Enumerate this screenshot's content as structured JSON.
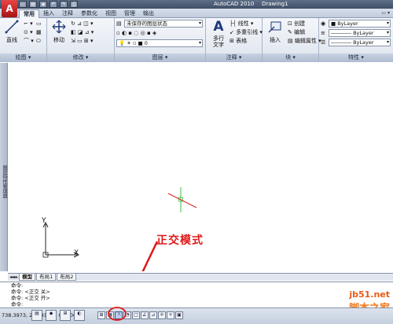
{
  "title_bar": {
    "app_title": "AutoCAD 2010",
    "doc_title": "Drawing1",
    "logo_letter": "A"
  },
  "ribbon_tabs": [
    "常用",
    "插入",
    "注释",
    "参数化",
    "视图",
    "管理",
    "输出"
  ],
  "panels": {
    "draw": {
      "title": "绘图",
      "line_label": "直线"
    },
    "modify": {
      "title": "修改",
      "move_label": "移动"
    },
    "layers": {
      "title": "图层",
      "layer_state": "未保存的图层状态",
      "current_layer": "0"
    },
    "annotation": {
      "title": "注释",
      "mtext_label": "多行\n文字",
      "linear": "线性",
      "multileader": "多重引线",
      "table": "表格"
    },
    "block": {
      "title": "块",
      "insert": "插入",
      "create": "创建",
      "edit": "编辑",
      "edit_attr": "编辑属性"
    },
    "properties": {
      "title": "特性",
      "color": "ByLayer",
      "linetype": "ByLayer",
      "lineweight": "ByLayer"
    }
  },
  "left_strip_text": "图层特性管理器",
  "ucs": {
    "x_label": "X",
    "y_label": "Y"
  },
  "layout_tabs": [
    "模型",
    "布局1",
    "布局2"
  ],
  "command_lines": [
    "命令:",
    "命令: <正交 关>",
    "命令: <正交 开>",
    "命令:"
  ],
  "status": {
    "coords": "738.3973, 280.9165 , 0.0000"
  },
  "annotation": {
    "label": "正交模式",
    "color": "#e01818"
  },
  "watermark": {
    "site": "jb51.net",
    "name": "脚本之家"
  },
  "colors": {
    "crosshair": "#3cbf3c",
    "ortho_line": "#d62020"
  }
}
